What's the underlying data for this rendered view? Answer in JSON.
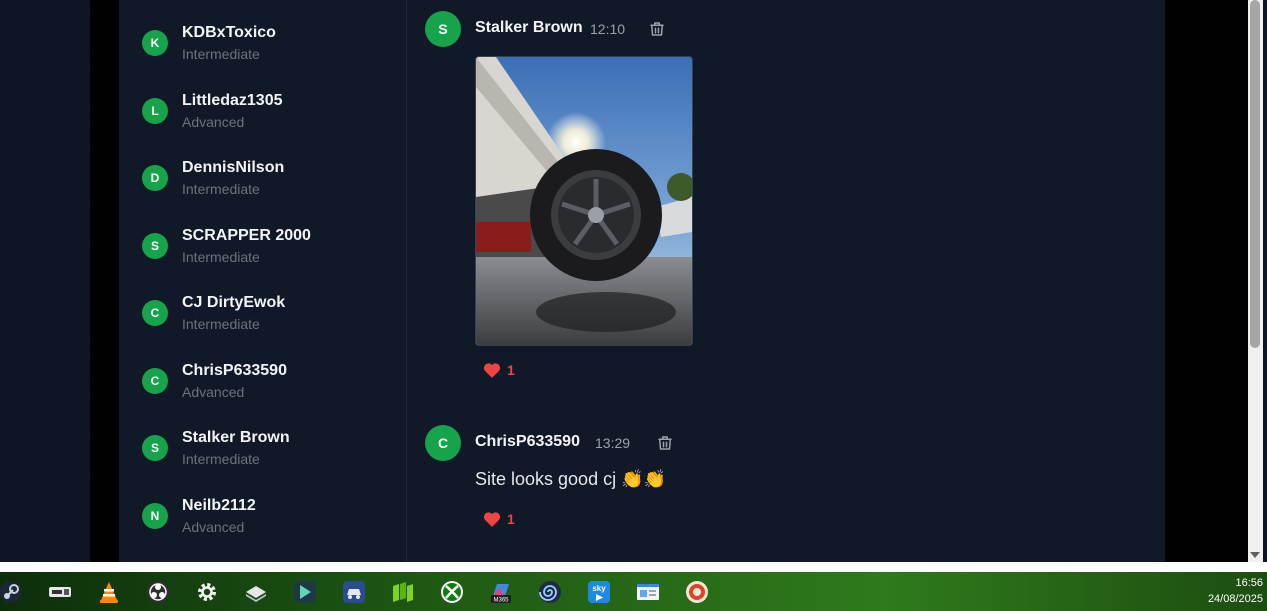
{
  "members": [
    {
      "initial": "K",
      "name": "KDBxToxico",
      "level": "Intermediate"
    },
    {
      "initial": "L",
      "name": "Littledaz1305",
      "level": "Advanced"
    },
    {
      "initial": "D",
      "name": "DennisNilson",
      "level": "Intermediate"
    },
    {
      "initial": "S",
      "name": "SCRAPPER 2000",
      "level": "Intermediate"
    },
    {
      "initial": "C",
      "name": "CJ DirtyEwok",
      "level": "Intermediate"
    },
    {
      "initial": "C",
      "name": "ChrisP633590",
      "level": "Advanced"
    },
    {
      "initial": "S",
      "name": "Stalker Brown",
      "level": "Intermediate"
    },
    {
      "initial": "N",
      "name": "Neilb2112",
      "level": "Advanced"
    }
  ],
  "messages": [
    {
      "initial": "S",
      "author": "Stalker Brown",
      "time": "12:10",
      "reaction_count": "1"
    },
    {
      "initial": "C",
      "author": "ChrisP633590",
      "time": "13:29",
      "text": "Site looks good cj 👏👏",
      "reaction_count": "1"
    }
  ],
  "taskbar": {
    "icons": [
      "steam-icon",
      "tubi-icon",
      "vlc-icon",
      "obs-icon",
      "settings-icon",
      "stack-icon",
      "filmora-icon",
      "car-icon",
      "columns-icon",
      "xbox-icon",
      "m365-icon",
      "spiral-icon",
      "sky-icon",
      "window-icon",
      "game-icon"
    ],
    "m365_label": "M365",
    "sky_label": "sky",
    "time": "16:56",
    "date": "24/08/2025"
  },
  "colors": {
    "accent": "#16a34a",
    "heart": "#ef4444",
    "background": "#111827"
  }
}
